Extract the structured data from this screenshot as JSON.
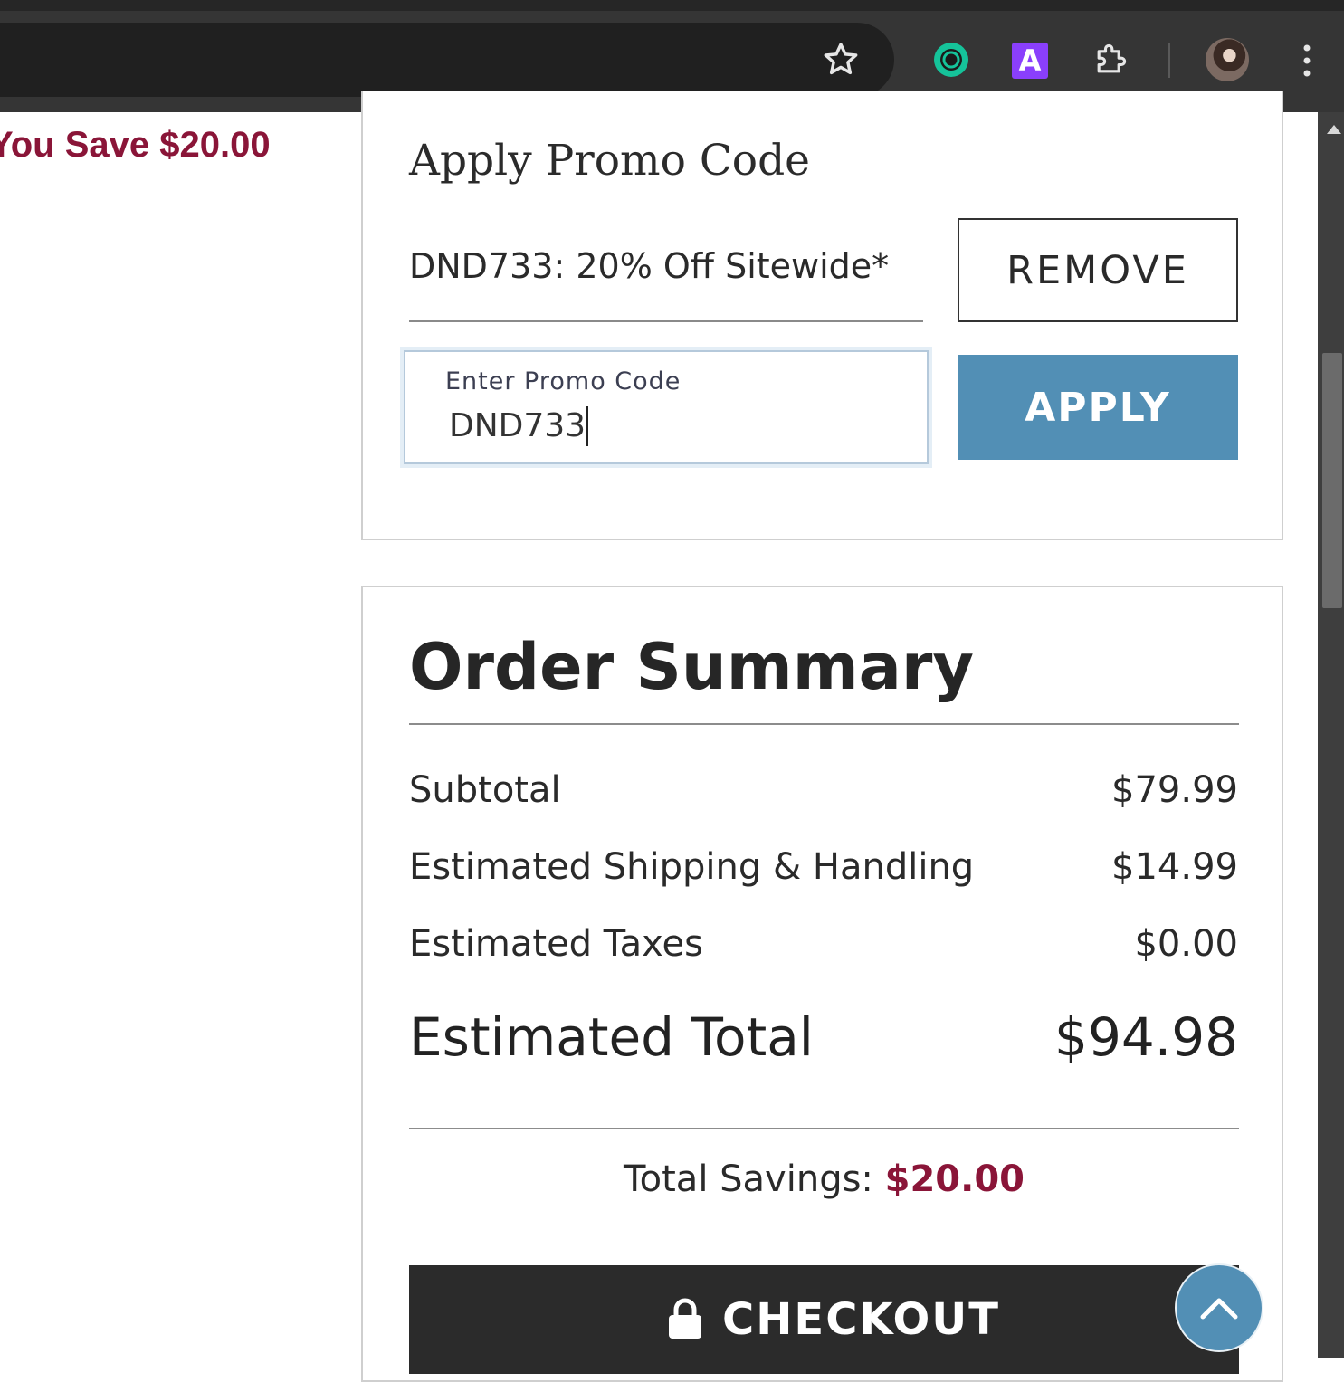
{
  "browser": {
    "extension_a_label": "A",
    "icons": [
      "star-icon",
      "grammarly-icon",
      "extension-a-icon",
      "puzzle-icon",
      "profile-avatar",
      "menu-icon"
    ]
  },
  "left_column": {
    "you_save_text": "You Save $20.00"
  },
  "promo": {
    "title": "Apply Promo Code",
    "applied_code_text": "DND733: 20% Off Sitewide*",
    "remove_label": "REMOVE",
    "input_label": "Enter Promo Code",
    "input_value": "DND733",
    "apply_label": "APPLY"
  },
  "summary": {
    "title": "Order Summary",
    "rows": [
      {
        "label": "Subtotal",
        "value": "$79.99"
      },
      {
        "label": "Estimated Shipping & Handling",
        "value": "$14.99"
      },
      {
        "label": "Estimated Taxes",
        "value": "$0.00"
      }
    ],
    "total_label": "Estimated Total",
    "total_value": "$94.98",
    "savings_label": "Total Savings:",
    "savings_value": "$20.00",
    "checkout_label": "CHECKOUT"
  },
  "colors": {
    "accent_blue": "#528fb5",
    "savings_red": "#8a1538",
    "checkout_dark": "#2b2b2b"
  }
}
